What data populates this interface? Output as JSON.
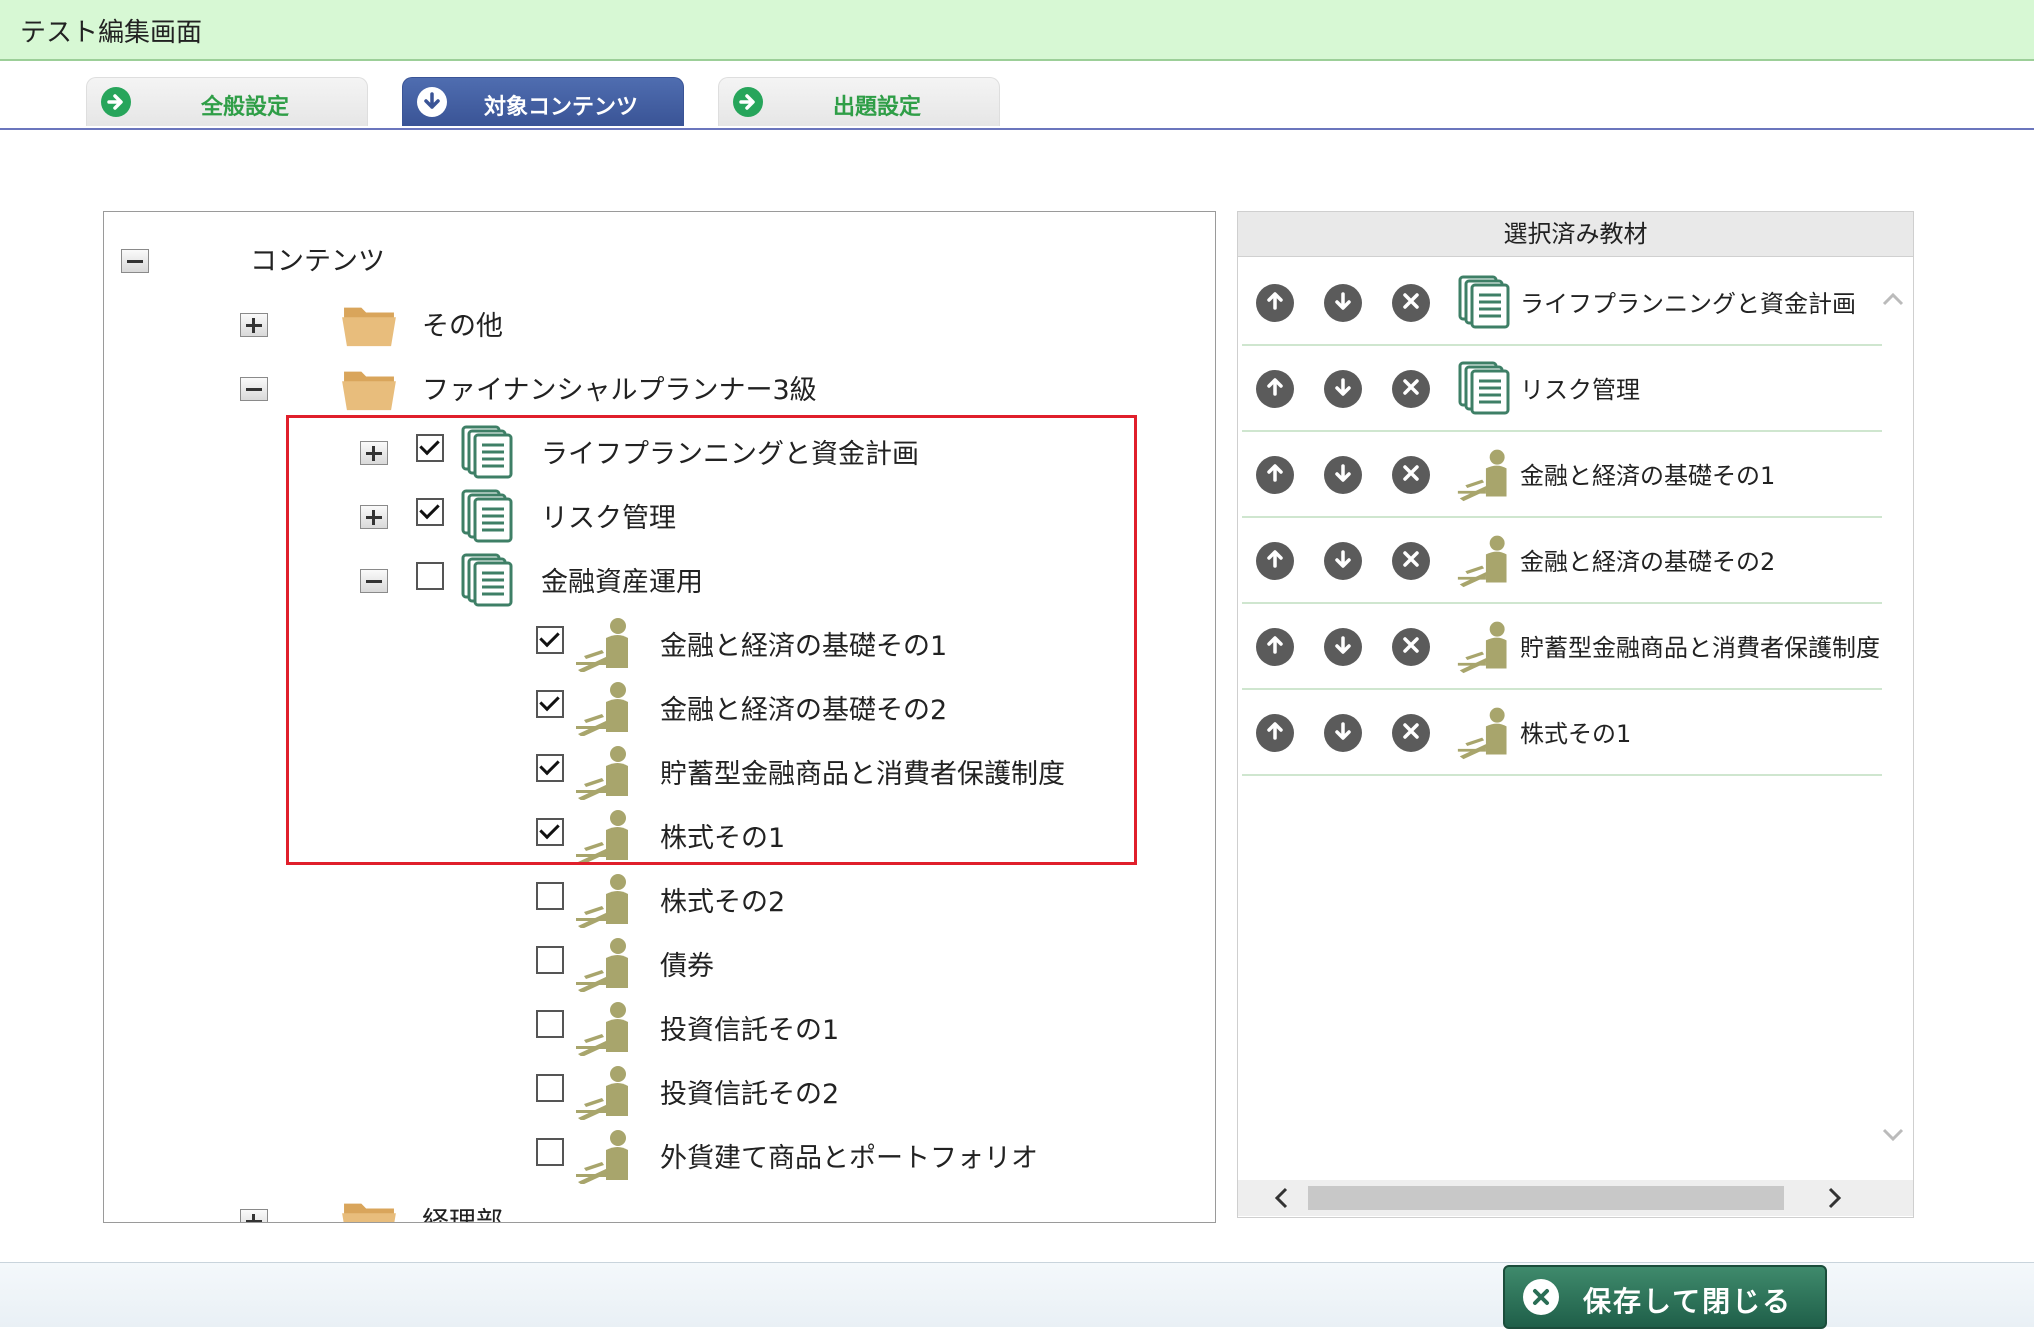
{
  "window": {
    "title": "テスト編集画面"
  },
  "tabs": [
    {
      "label": "全般設定",
      "icon": "arrow-right-circle-icon",
      "active": false
    },
    {
      "label": "対象コンテンツ",
      "icon": "arrow-down-circle-icon",
      "active": true
    },
    {
      "label": "出題設定",
      "icon": "arrow-right-circle-icon",
      "active": false
    }
  ],
  "tree": {
    "root": {
      "label": "コンテンツ",
      "expanded": true
    },
    "folders": [
      {
        "label": "その他",
        "expanded": false
      },
      {
        "label": "ファイナンシャルプランナー3級",
        "expanded": true
      },
      {
        "label": "経理部",
        "expanded": false
      }
    ],
    "units": [
      {
        "label": "ライフプランニングと資金計画",
        "checked": true,
        "expanded": false
      },
      {
        "label": "リスク管理",
        "checked": true,
        "expanded": false
      },
      {
        "label": "金融資産運用",
        "checked": false,
        "expanded": true
      }
    ],
    "lessons": [
      {
        "label": "金融と経済の基礎その1",
        "checked": true
      },
      {
        "label": "金融と経済の基礎その2",
        "checked": true
      },
      {
        "label": "貯蓄型金融商品と消費者保護制度",
        "checked": true
      },
      {
        "label": "株式その1",
        "checked": true
      },
      {
        "label": "株式その2",
        "checked": false
      },
      {
        "label": "債券",
        "checked": false
      },
      {
        "label": "投資信託その1",
        "checked": false
      },
      {
        "label": "投資信託その2",
        "checked": false
      },
      {
        "label": "外貨建て商品とポートフォリオ",
        "checked": false
      }
    ]
  },
  "selected": {
    "header": "選択済み教材",
    "items": [
      {
        "label": "ライフプランニングと資金計画",
        "type": "unit"
      },
      {
        "label": "リスク管理",
        "type": "unit"
      },
      {
        "label": "金融と経済の基礎その1",
        "type": "lesson"
      },
      {
        "label": "金融と経済の基礎その2",
        "type": "lesson"
      },
      {
        "label": "貯蓄型金融商品と消費者保護制度",
        "type": "lesson"
      },
      {
        "label": "株式その1",
        "type": "lesson"
      }
    ]
  },
  "footer": {
    "save_close_label": "保存して閉じる"
  },
  "colors": {
    "titlebar_bg": "#d7f8d4",
    "tab_active": "#3a5496",
    "tab_icon_green": "#27a55b",
    "highlight_red": "#e01f2b",
    "folder": "#e3b36f",
    "doc_green": "#3e7f66",
    "lesson_olive": "#a8a56c",
    "save_button": "#2a6e55"
  }
}
